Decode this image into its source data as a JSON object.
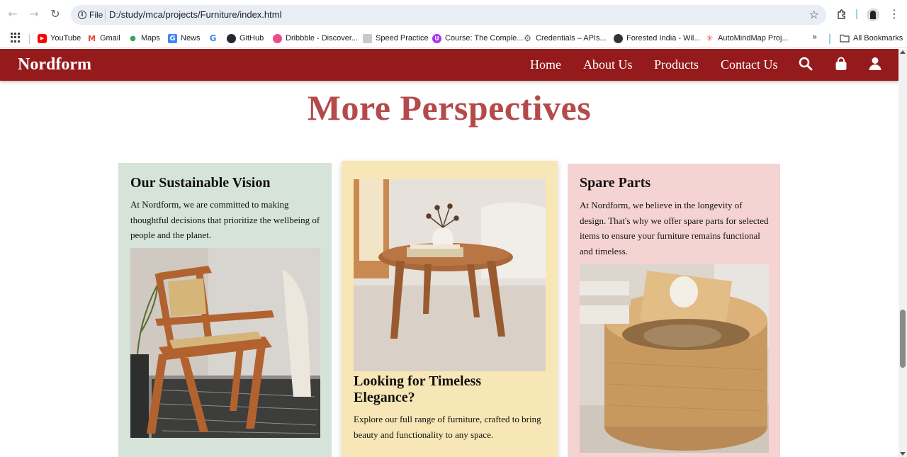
{
  "browser": {
    "back_icon": "arrow-left-icon",
    "forward_icon": "arrow-right-icon",
    "reload_icon": "reload-icon",
    "file_chip": "File",
    "url": "D:/study/mca/projects/Furniture/index.html",
    "bookmarks": [
      {
        "label": "YouTube",
        "icon": "youtube-icon",
        "color": "#ff0000"
      },
      {
        "label": "Gmail",
        "icon": "gmail-icon",
        "color": "#ea4335"
      },
      {
        "label": "Maps",
        "icon": "maps-icon",
        "color": "#34a853"
      },
      {
        "label": "News",
        "icon": "news-icon",
        "color": "#4285f4"
      },
      {
        "label": "",
        "icon": "google-icon",
        "color": "#4285f4"
      },
      {
        "label": "GitHub",
        "icon": "github-icon",
        "color": "#24292e"
      },
      {
        "label": "Dribbble - Discover...",
        "icon": "dribbble-icon",
        "color": "#ea4c89"
      },
      {
        "label": "Speed Practice",
        "icon": "speed-practice-icon",
        "color": "#777777"
      },
      {
        "label": "Course: The Comple...",
        "icon": "course-icon",
        "color": "#a435f0"
      },
      {
        "label": "Credentials – APIs...",
        "icon": "credentials-icon",
        "color": "#5f6368"
      },
      {
        "label": "Forested India - Wil...",
        "icon": "wikipedia-icon",
        "color": "#333333"
      },
      {
        "label": "AutoMindMap Proj...",
        "icon": "automindmap-icon",
        "color": "#e8624a"
      }
    ],
    "more_bookmarks": "»",
    "all_bookmarks": "All Bookmarks"
  },
  "site": {
    "brand": "Nordform",
    "menu": [
      "Home",
      "About Us",
      "Products",
      "Contact Us"
    ],
    "icons": [
      "search-icon",
      "shopping-bag-icon",
      "user-icon"
    ]
  },
  "section": {
    "title": "More Perspectives"
  },
  "cards": [
    {
      "title": "Our Sustainable Vision",
      "text": "At Nordform, we are committed to making thoughtful decisions that prioritize the wellbeing of people and the planet.",
      "bg": "#d5e3d8"
    },
    {
      "title": "Looking for Timeless Elegance?",
      "text": "Explore our full range of furniture, crafted to bring beauty and functionality to any space.",
      "bg": "#f8e7b6"
    },
    {
      "title": "Spare Parts",
      "text": "At Nordform, we believe in the longevity of design. That's why we offer spare parts for selected items to ensure your furniture remains functional and timeless.",
      "bg": "#f6d3d3"
    }
  ],
  "colors": {
    "nav_bg": "#951a1c",
    "title": "#b44a4b"
  }
}
